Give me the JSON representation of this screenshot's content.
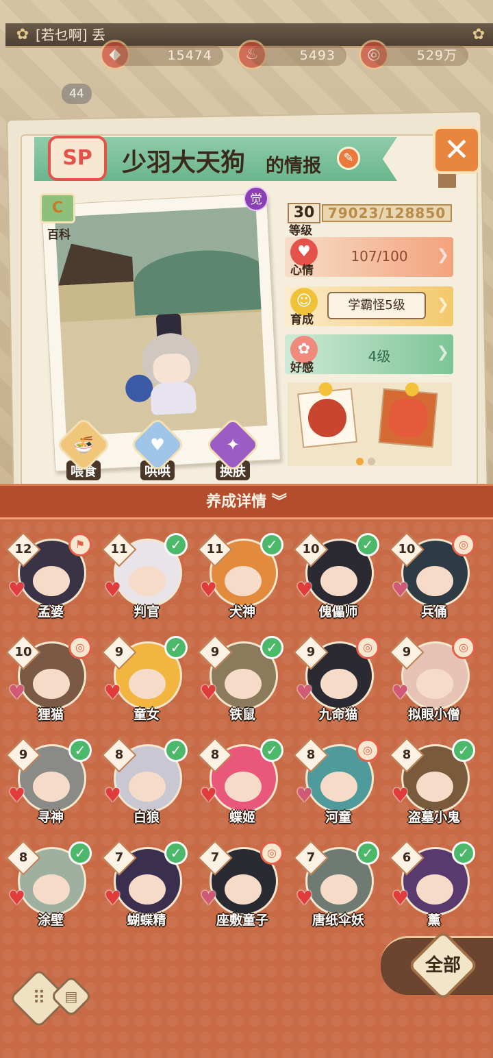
{
  "topbar": {
    "chat_text": "[若乜啊] 丢"
  },
  "resources": {
    "jade": "15474",
    "stamina": "5493",
    "gold": "529万"
  },
  "player_level": "44",
  "card": {
    "rarity": "SP",
    "shikigami_name": "少羽大天狗",
    "title_suffix": "的情报",
    "awaken_label": "觉",
    "encyclopedia_label": "百科",
    "level": "30",
    "level_label": "等级",
    "exp": "79023/128850",
    "mood_label": "心情",
    "mood_value": "107/100",
    "train_label": "育成",
    "train_value": "学霸怪5级",
    "favor_label": "好感",
    "favor_value": "4级",
    "actions": [
      {
        "label": "喂食",
        "icon": "noodle-bowl-icon"
      },
      {
        "label": "哄哄",
        "icon": "milk-carton-icon"
      },
      {
        "label": "换肤",
        "icon": "kimono-icon"
      }
    ]
  },
  "detail_section": {
    "title": "养成详情",
    "toggle_icon": "double-chevron-down-icon"
  },
  "shikigami_list": [
    {
      "level": "12",
      "name": "孟婆",
      "status": "flag",
      "color": "#3a3346"
    },
    {
      "level": "11",
      "name": "判官",
      "status": "check",
      "color": "#e9e4ea"
    },
    {
      "level": "11",
      "name": "犬神",
      "status": "check",
      "color": "#e38b3c"
    },
    {
      "level": "10",
      "name": "傀儡师",
      "status": "check",
      "color": "#2b2a33"
    },
    {
      "level": "10",
      "name": "兵俑",
      "status": "ring",
      "color": "#2e3a44"
    },
    {
      "level": "10",
      "name": "狸猫",
      "status": "ring",
      "color": "#7a5a44"
    },
    {
      "level": "9",
      "name": "童女",
      "status": "check",
      "color": "#f2b540"
    },
    {
      "level": "9",
      "name": "铁鼠",
      "status": "check",
      "color": "#8b7a5c"
    },
    {
      "level": "9",
      "name": "九命猫",
      "status": "ring",
      "color": "#2b2a33"
    },
    {
      "level": "9",
      "name": "拟眼小僧",
      "status": "ring",
      "color": "#e6c3b4"
    },
    {
      "level": "9",
      "name": "寻神",
      "status": "check",
      "color": "#8a8a86"
    },
    {
      "level": "8",
      "name": "白狼",
      "status": "check",
      "color": "#c9c8d2"
    },
    {
      "level": "8",
      "name": "蝶姬",
      "status": "check",
      "color": "#e9577a"
    },
    {
      "level": "8",
      "name": "河童",
      "status": "ring",
      "color": "#4f9a9a"
    },
    {
      "level": "8",
      "name": "盗墓小鬼",
      "status": "check",
      "color": "#7a5a3c"
    },
    {
      "level": "8",
      "name": "涂壁",
      "status": "check",
      "color": "#9fb0a0"
    },
    {
      "level": "7",
      "name": "蝴蝶精",
      "status": "check",
      "color": "#3a2f4e"
    },
    {
      "level": "7",
      "name": "座敷童子",
      "status": "ring",
      "color": "#2a2a32"
    },
    {
      "level": "7",
      "name": "唐纸伞妖",
      "status": "check",
      "color": "#6e7a72"
    },
    {
      "level": "6",
      "name": "薰",
      "status": "check",
      "color": "#5a3a6e"
    }
  ],
  "controls": {
    "all_label": "全部"
  }
}
